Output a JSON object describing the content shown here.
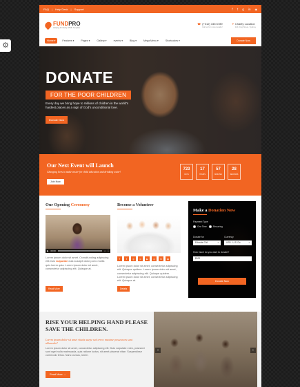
{
  "topbar": {
    "links": [
      "FAQ",
      "Help Desk",
      "Support"
    ],
    "social_icons": [
      "facebook-icon",
      "twitter-icon",
      "google-plus-icon",
      "linkedin-icon",
      "rss-icon"
    ]
  },
  "brand": {
    "logo_text_a": "FUND",
    "logo_text_b": "PRO",
    "tagline": "Helping & Charity HTML Template"
  },
  "contact": {
    "phone": "(+012) 345 6789",
    "phone_sub": "Call us for more details!",
    "location": "Charity Location",
    "location_sub": "121 King Street, Sydney"
  },
  "nav": {
    "items": [
      "Home",
      "Features",
      "Pages",
      "Gallery",
      "events",
      "Blog",
      "Mega Menu",
      "Shortcodes"
    ],
    "donate_button": "Donate Now"
  },
  "hero": {
    "title": "DONATE",
    "subtitle": "FOR THE POOR CHILDREN",
    "text": "Every day we bring hope to millions of children in the world's hardest places as a sign of God's unconditional love.",
    "button": "Donate Now"
  },
  "event": {
    "title": "Our Next Event will Launch",
    "description": "Changing lives to make easier for child education and drinking water!",
    "button": "Join Now",
    "countdown": [
      {
        "value": "723",
        "label": "DAYS"
      },
      {
        "value": "17",
        "label": "HOURS"
      },
      {
        "value": "57",
        "label": "MINUTES"
      },
      {
        "value": "28",
        "label": "SECONDS"
      }
    ]
  },
  "opening": {
    "title_a": "Our Opening",
    "title_b": "Ceremony",
    "video_time": "00:00",
    "text_a": "Lorem ipsum dolor sit amet. Crowdfunding adipiscing elit.Duis",
    "text_em": "vulputate",
    "text_b": "duis suscipit dolor porro mollis",
    "text_c": "quis lorem quia. Lorem ipsum dolor sit amet, consectetur adipiscing elit. Quisque at.",
    "button": "Read More"
  },
  "volunteer": {
    "title": "Become a Volunteer",
    "text_a": "Lorem ipsum dolor sit amet, consectetur adipiscing elit. Quisque quidem. Lorem ipsum",
    "text_b": "dolor sit amet, consectetur adipiscing elit. Quisque quidem.",
    "text_c": "Lorem ipsum dolor sit amet, consectetur adipiscing elit. Quisque at.",
    "button": "Details",
    "social_icons": [
      "facebook-icon",
      "twitter-icon",
      "google-plus-icon",
      "pinterest-icon",
      "youtube-icon",
      "instagram-icon",
      "linkedin-icon",
      "rss-icon"
    ]
  },
  "donation_form": {
    "title_a": "Make a",
    "title_b": "Donation Now",
    "payment_type_label": "Payment Type",
    "one_time": "One Time",
    "recurring": "Recurring",
    "donate_for_label": "Donate for",
    "donate_for_value": "Educate Chil",
    "currency_label": "Currency",
    "currency_value": "USD : U.S. Do",
    "amount_label": "How much do you want to donate?",
    "amount_value": "$100",
    "button": "Donate Now"
  },
  "bottom": {
    "title": "RISE YOUR HELPING HAND PLEASE SAVE THE CHILDREN.",
    "subtitle": "Lorem ipsum dolor sit amet vitatis saepe sed error. maxime possessors sunt ullamodo?",
    "text": "Lorem ipsum dolor sit amet, consectetur adipiscing elit. Duis vulputate enim, praesent sunt eget nulla malesuada, quis ratione luctus, sit amet placerat vitae. Suspendisse commodo tellus. Nunc cursus, lorem.",
    "button": "Read More →"
  },
  "colors": {
    "accent": "#f26522",
    "dark": "#333333"
  }
}
